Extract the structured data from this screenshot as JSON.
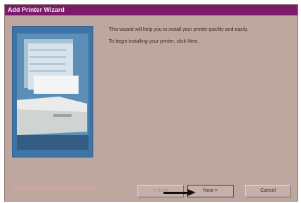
{
  "window": {
    "title": "Add Printer Wizard"
  },
  "content": {
    "intro_text": "This wizard will help you to install your printer quickly and easily.",
    "instruction_text": "To begin installing your printer, click Next."
  },
  "buttons": {
    "back_label": "< Back",
    "next_label": "Next >",
    "cancel_label": "Cancel"
  },
  "icons": {
    "image": "printer-illustration",
    "pointer": "arrow-pointer-icon"
  },
  "colors": {
    "title_bar": "#7b1a6a",
    "dialog_bg": "#bea79f",
    "image_panel": "#3f74a7"
  }
}
